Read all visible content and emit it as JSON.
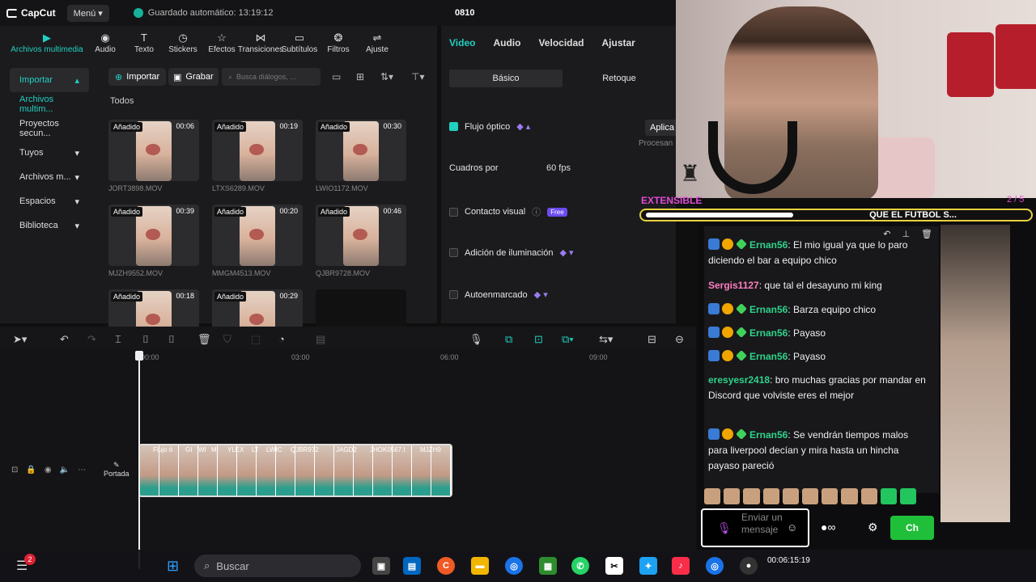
{
  "app": {
    "name": "CapCut",
    "menu": "Menú",
    "autosave": "Guardado automático: 13:19:12",
    "project": "0810"
  },
  "media_tools": [
    {
      "label": "Archivos multimedia",
      "icon": "film-icon"
    },
    {
      "label": "Audio",
      "icon": "music-icon"
    },
    {
      "label": "Texto",
      "icon": "text-icon"
    },
    {
      "label": "Stickers",
      "icon": "sticker-icon"
    },
    {
      "label": "Efectos",
      "icon": "sparkle-icon"
    },
    {
      "label": "Transiciones",
      "icon": "transition-icon"
    },
    {
      "label": "Subtítulos",
      "icon": "subtitle-icon"
    },
    {
      "label": "Filtros",
      "icon": "filter-icon"
    },
    {
      "label": "Ajuste",
      "icon": "adjust-icon"
    }
  ],
  "sidebar": [
    {
      "label": "Importar"
    },
    {
      "label": "Archivos multim..."
    },
    {
      "label": "Proyectos secun..."
    },
    {
      "label": "Tuyos"
    },
    {
      "label": "Archivos m..."
    },
    {
      "label": "Espacios"
    },
    {
      "label": "Biblioteca"
    }
  ],
  "media": {
    "import": "Importar",
    "record": "Grabar",
    "search_placeholder": "Busca diálogos, ...",
    "all": "Todos",
    "clips": [
      {
        "badge": "Añadido",
        "duration": "00:06",
        "name": "JORT3898.MOV"
      },
      {
        "badge": "Añadido",
        "duration": "00:19",
        "name": "LTXS6289.MOV"
      },
      {
        "badge": "Añadido",
        "duration": "00:30",
        "name": "LWIO1172.MOV"
      },
      {
        "badge": "Añadido",
        "duration": "00:39",
        "name": "MJZH9552.MOV"
      },
      {
        "badge": "Añadido",
        "duration": "00:20",
        "name": "MMGM4513.MOV"
      },
      {
        "badge": "Añadido",
        "duration": "00:46",
        "name": "QJBR9728.MOV"
      },
      {
        "badge": "Añadido",
        "duration": "00:18",
        "name": ""
      },
      {
        "badge": "Añadido",
        "duration": "00:29",
        "name": ""
      },
      {
        "badge": "",
        "duration": "",
        "name": ""
      }
    ]
  },
  "props": {
    "tabs": [
      "Video",
      "Audio",
      "Velocidad",
      "Ajustar"
    ],
    "seg": [
      "Básico",
      "Retoque"
    ],
    "flujo": "Flujo óptico",
    "aplica": "Aplica",
    "procesan": "Procesan",
    "cuadros": "Cuadros por",
    "fps": "60 fps",
    "contacto": "Contacto visual",
    "free": "Free",
    "iluminacion": "Adición de iluminación",
    "autoenmarcado": "Autoenmarcado"
  },
  "timeline": {
    "ticks": [
      "00:00",
      "03:00",
      "06:00",
      "09:00"
    ],
    "portada": "Portada",
    "clip_labels": [
      "Flujo ó",
      "GI",
      "WI",
      "MI",
      "YLEX",
      "LT",
      "LWIC",
      "QJBR972",
      "JAGD2",
      "JHOK0567.I",
      "MJZH9"
    ]
  },
  "overlay": {
    "ext": "EXTENSIBLE",
    "pages": "2 / 5",
    "ticker": "QUE EL FUTBOL S...",
    "messages": [
      {
        "user": "Ernan56",
        "text": "El mio igual ya que lo paro diciendo el bar a equipo chico",
        "badges": true,
        "color": "#2fd38a"
      },
      {
        "user": "Sergis1127",
        "text": "que tal el desayuno mi king",
        "badges": false,
        "color": "#ff7fbf"
      },
      {
        "user": "Ernan56",
        "text": "Barza equipo chico",
        "badges": true,
        "color": "#2fd38a"
      },
      {
        "user": "Ernan56",
        "text": "Payaso",
        "badges": true,
        "color": "#2fd38a"
      },
      {
        "user": "Ernan56",
        "text": "Payaso",
        "badges": true,
        "color": "#2fd38a"
      },
      {
        "user": "eresyesr2418",
        "text": "bro muchas gracias por mandar en Discord que volviste eres el mejor",
        "badges": false,
        "color": "#2fd38a"
      },
      {
        "user": "Ernan56",
        "text": "Se vendrán tiempos malos para liverpool decían y mira hasta un hincha payaso pareció",
        "badges": true,
        "color": "#2fd38a"
      }
    ],
    "chat_placeholder": "Enviar un mensaje",
    "chat_button": "Ch"
  },
  "taskbar": {
    "search": "Buscar",
    "notif": "2",
    "rec_time": "00:06:15:19"
  },
  "colors": {
    "accent": "#20d0c0",
    "ticker_border": "#e8d040"
  }
}
